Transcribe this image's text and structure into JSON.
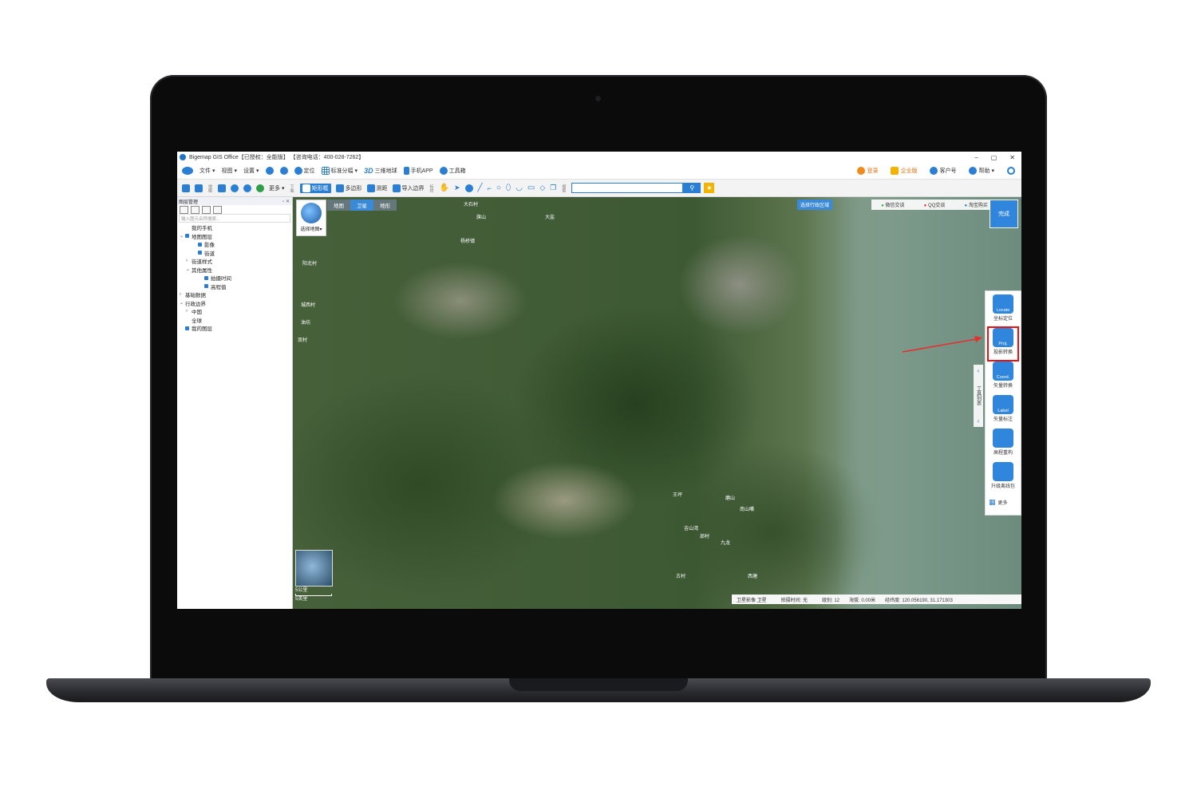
{
  "window": {
    "title": "Bigemap GIS Office【已授权：全能版】 【咨询电话：400-028-7262】",
    "controls": [
      "–",
      "▢",
      "✕"
    ]
  },
  "menubar": {
    "items": [
      {
        "label": "文件",
        "icon": "file-icon"
      },
      {
        "label": "视图",
        "icon": "view-icon"
      },
      {
        "label": "设置",
        "icon": "settings-icon"
      },
      {
        "label": "",
        "icon": "zoom-in-icon"
      },
      {
        "label": "",
        "icon": "zoom-out-icon"
      },
      {
        "label": "定位",
        "icon": "locate-pin-icon"
      },
      {
        "label": "标准分幅",
        "icon": "grid-icon"
      },
      {
        "label": "三维地球",
        "icon": "3d-icon"
      },
      {
        "label": "手机APP",
        "icon": "phone-icon"
      },
      {
        "label": "工具箱",
        "icon": "gear-icon"
      }
    ],
    "right": [
      {
        "label": "登录",
        "icon": "user-icon"
      },
      {
        "label": "企业版",
        "icon": "crown-icon"
      },
      {
        "label": "客户号",
        "icon": "service-icon"
      },
      {
        "label": "帮助",
        "icon": "help-icon"
      }
    ]
  },
  "toolbar": {
    "group1_label": "地图",
    "more": "更多",
    "group2_label": "下载",
    "rect": "矩形框",
    "polygon": "多边形",
    "measure": "测距",
    "import": "导入边界",
    "group3_label": "标绘",
    "search_label": "搜索",
    "search_placeholder": ""
  },
  "layers_panel": {
    "title": "图层管理",
    "filter_placeholder": "输入图元名称搜索...",
    "tree": [
      {
        "label": "我的手机",
        "indent": 1,
        "exp": "",
        "check": false
      },
      {
        "label": "地图图层",
        "indent": 0,
        "exp": "⌄",
        "check": true
      },
      {
        "label": "影像",
        "indent": 2,
        "exp": "",
        "check": true
      },
      {
        "label": "街道",
        "indent": 2,
        "exp": "",
        "check": true
      },
      {
        "label": "街道样式",
        "indent": 1,
        "exp": "›",
        "check": false
      },
      {
        "label": "其他属性",
        "indent": 1,
        "exp": "⌄",
        "check": false
      },
      {
        "label": "拍摄时间",
        "indent": 3,
        "exp": "",
        "check": true
      },
      {
        "label": "高程值",
        "indent": 3,
        "exp": "",
        "check": true
      },
      {
        "label": "基础数据",
        "indent": 0,
        "exp": "›",
        "check": false
      },
      {
        "label": "行政边界",
        "indent": 0,
        "exp": "⌄",
        "check": false
      },
      {
        "label": "中国",
        "indent": 1,
        "exp": "›",
        "check": false
      },
      {
        "label": "全球",
        "indent": 1,
        "exp": "",
        "check": false
      },
      {
        "label": "我的图层",
        "indent": 0,
        "exp": "",
        "check": true
      }
    ]
  },
  "map": {
    "tabs": [
      "地图",
      "卫星",
      "地形"
    ],
    "selected_tab": "卫星",
    "select_map": "选择地图▾",
    "admin_region": "选择行政区域",
    "top_links": [
      "微信交谈",
      "QQ交谈",
      "淘宝购买"
    ],
    "done": "完成",
    "scale_lines": [
      "5公里",
      "5英里"
    ],
    "labels": [
      {
        "text": "大石村"
      },
      {
        "text": "旗山"
      },
      {
        "text": "杨桥镇"
      },
      {
        "text": "阳北村"
      },
      {
        "text": "城西村"
      },
      {
        "text": "双村"
      },
      {
        "text": "大盐"
      },
      {
        "text": "油坊"
      },
      {
        "text": "磨山"
      },
      {
        "text": "南山嘴"
      },
      {
        "text": "吉山湾"
      },
      {
        "text": "郯村"
      },
      {
        "text": "王坪"
      },
      {
        "text": "西塘"
      },
      {
        "text": "古村"
      },
      {
        "text": "九龙"
      }
    ],
    "status": {
      "source": "卫星影像 卫星",
      "shot_time": "拍摄时间: 无",
      "level": "级别: 12",
      "altitude": "海拔: 0.00米",
      "coords": "经纬度: 120.056190, 31.171303"
    }
  },
  "tool_panel": {
    "list_title": "工具列表",
    "tools": [
      {
        "name": "locate",
        "icon_text": "Locate",
        "label": "坐标定位",
        "icon": "location-pin-icon",
        "highlight": false
      },
      {
        "name": "proj",
        "icon_text": "Proj.",
        "label": "投影转换",
        "icon": "grid-icon",
        "highlight": true
      },
      {
        "name": "coord",
        "icon_text": "Coord.",
        "label": "矢量转换",
        "icon": "globe-icon",
        "highlight": false
      },
      {
        "name": "label",
        "icon_text": "Label",
        "label": "矢量标注",
        "icon": "pen-icon",
        "highlight": false
      },
      {
        "name": "elev",
        "icon_text": "",
        "label": "高程重构",
        "icon": "mountain-icon",
        "highlight": false
      },
      {
        "name": "upgrade",
        "icon_text": "",
        "label": "升级离线包",
        "icon": "database-icon",
        "highlight": false
      }
    ],
    "more": "更多"
  },
  "colors": {
    "accent": "#2a7fd4",
    "highlight": "#e11111",
    "arrow": "#e53030"
  }
}
